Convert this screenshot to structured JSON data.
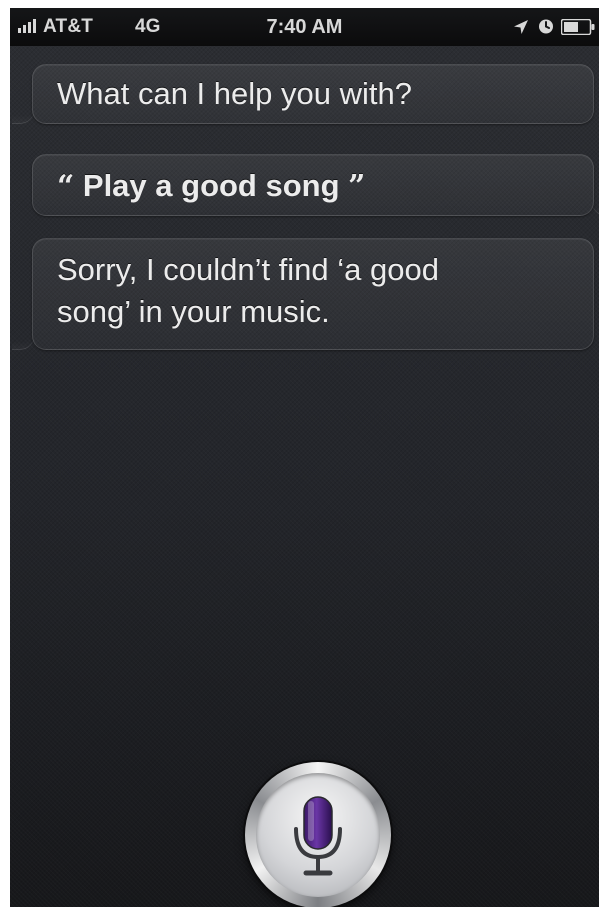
{
  "status_bar": {
    "carrier": "AT&T",
    "network": "4G",
    "time": "7:40 AM",
    "signal_bars": 4,
    "icons": [
      "signal-bars-icon",
      "location-arrow-icon",
      "alarm-clock-icon",
      "battery-icon"
    ]
  },
  "conversation": {
    "messages": [
      {
        "speaker": "assistant",
        "text": "What can I help you with?"
      },
      {
        "speaker": "user",
        "open_quote": "“",
        "text": "Play a good song",
        "close_quote": "”"
      },
      {
        "speaker": "assistant",
        "line1": "Sorry, I couldn’t find ‘a good",
        "line2": "song’ in your music."
      }
    ]
  },
  "controls": {
    "mic_button_icon": "microphone-icon",
    "mic_accent_color": "#5a2a8c"
  },
  "colors": {
    "background": "#26282c",
    "status_bar": "#0b0b0c",
    "text": "#ececec"
  }
}
